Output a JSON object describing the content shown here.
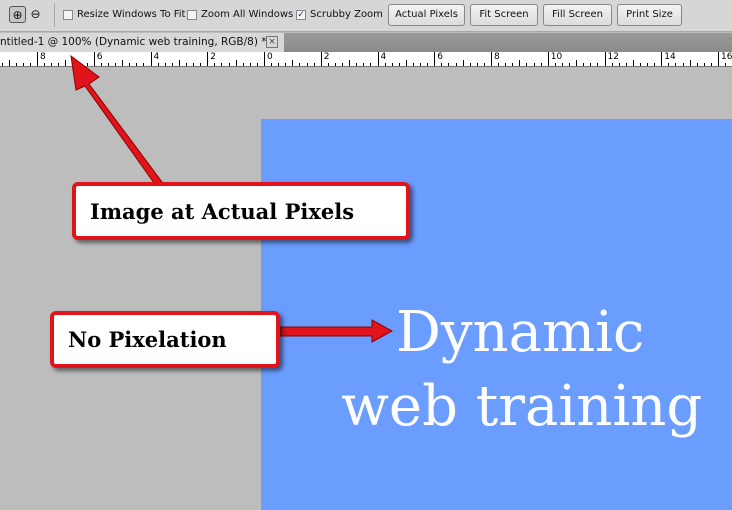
{
  "toolbar": {
    "zoom_in": "zoom-in",
    "zoom_out": "zoom-out",
    "checkboxes": [
      {
        "label": "Resize Windows To Fit",
        "checked": false
      },
      {
        "label": "Zoom All Windows",
        "checked": false
      },
      {
        "label": "Scrubby Zoom",
        "checked": true
      }
    ],
    "buttons": [
      "Actual Pixels",
      "Fit Screen",
      "Fill Screen",
      "Print Size"
    ]
  },
  "document_tab": {
    "title": "ntitled-1 @ 100% (Dynamic web training, RGB/8) *",
    "close": "×"
  },
  "ruler": {
    "labels": [
      "8",
      "6",
      "4",
      "2",
      "0",
      "2",
      "4",
      "6",
      "8",
      "10",
      "12",
      "14",
      "16"
    ]
  },
  "canvas": {
    "line1": "Dynamic",
    "line2": "web training",
    "color": "#6b9cff"
  },
  "callouts": {
    "actual_pixels": "Image at Actual Pixels",
    "no_pixelation": "No Pixelation",
    "color": "#e0141a"
  }
}
